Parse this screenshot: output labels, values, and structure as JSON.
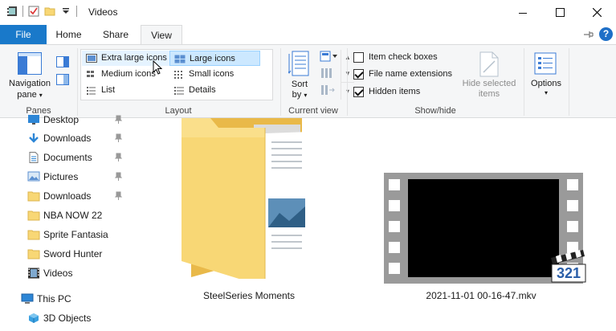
{
  "window": {
    "title": "Videos"
  },
  "tabs": [
    {
      "label": "File"
    },
    {
      "label": "Home"
    },
    {
      "label": "Share"
    },
    {
      "label": "View"
    }
  ],
  "panes": {
    "navigation_pane_line1": "Navigation",
    "navigation_pane_line2": "pane",
    "group_label": "Panes"
  },
  "layout": {
    "group_label": "Layout",
    "items": [
      {
        "label": "Extra large icons"
      },
      {
        "label": "Large icons"
      },
      {
        "label": "Medium icons"
      },
      {
        "label": "Small icons"
      },
      {
        "label": "List"
      },
      {
        "label": "Details"
      }
    ],
    "selected": "Large icons"
  },
  "current_view": {
    "sort_line1": "Sort",
    "sort_line2": "by",
    "group_label": "Current view"
  },
  "show_hide": {
    "group_label": "Show/hide",
    "item_check_boxes": {
      "label": "Item check boxes",
      "checked": false
    },
    "file_name_extensions": {
      "label": "File name extensions",
      "checked": true
    },
    "hidden_items": {
      "label": "Hidden items",
      "checked": true
    },
    "hide_selected_line1": "Hide selected",
    "hide_selected_line2": "items"
  },
  "options": {
    "label": "Options"
  },
  "nav": {
    "items": [
      {
        "label": "Desktop",
        "icon": "desktop-icon",
        "pinned": true
      },
      {
        "label": "Downloads",
        "icon": "download-arrow-icon",
        "pinned": true
      },
      {
        "label": "Documents",
        "icon": "documents-icon",
        "pinned": true
      },
      {
        "label": "Pictures",
        "icon": "pictures-icon",
        "pinned": true
      },
      {
        "label": "Downloads",
        "icon": "folder-icon",
        "pinned": true
      },
      {
        "label": "NBA NOW 22",
        "icon": "folder-icon",
        "pinned": false
      },
      {
        "label": "Sprite Fantasia",
        "icon": "folder-icon",
        "pinned": false
      },
      {
        "label": "Sword Hunter",
        "icon": "folder-icon",
        "pinned": false
      },
      {
        "label": "Videos",
        "icon": "videos-icon",
        "pinned": false
      },
      {
        "label": "This PC",
        "icon": "this-pc-icon",
        "pinned": false
      },
      {
        "label": "3D Objects",
        "icon": "3d-objects-icon",
        "pinned": false
      }
    ]
  },
  "files": [
    {
      "name": "SteelSeries Moments",
      "type": "folder"
    },
    {
      "name": "2021-11-01 00-16-47.mkv",
      "type": "video"
    }
  ],
  "badge_text": "321",
  "colors": {
    "accent": "#1979ca",
    "folder": "#f8d775",
    "selection": "#cce8ff"
  }
}
